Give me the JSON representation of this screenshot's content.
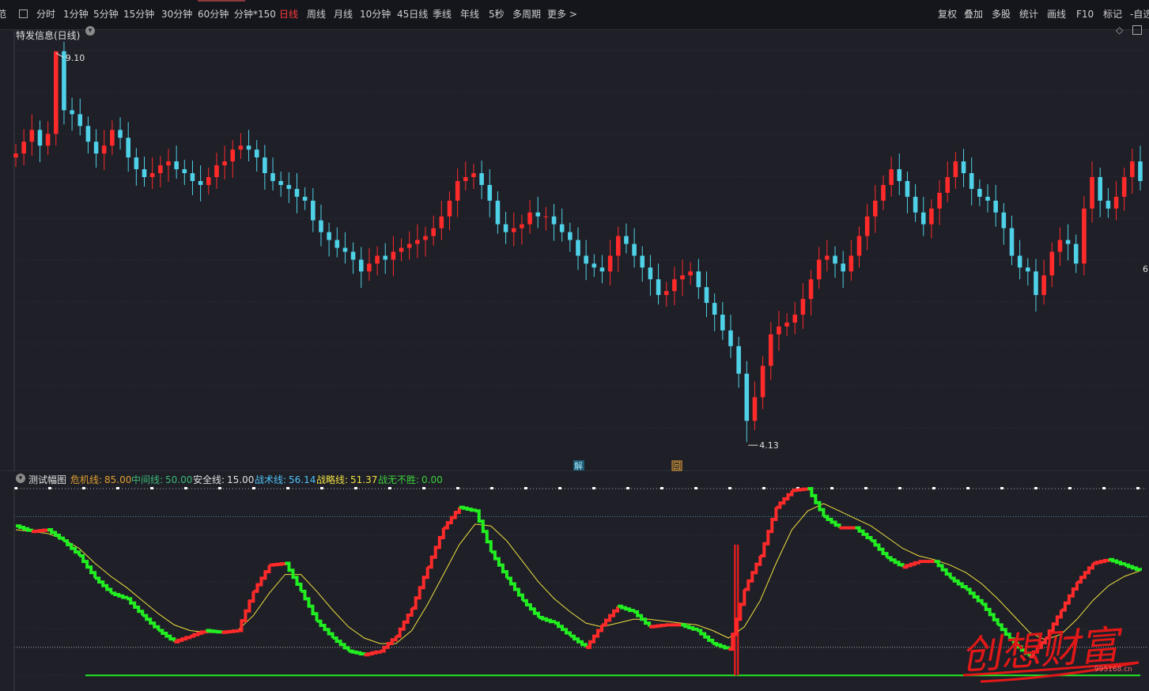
{
  "toolbar": {
    "left_fragment": "范",
    "periods": [
      "分时",
      "1分钟",
      "5分钟",
      "15分钟",
      "30分钟",
      "60分钟",
      "分钟*150",
      "日线",
      "周线",
      "月线",
      "10分钟",
      "45日线",
      "季线",
      "年线",
      "5秒",
      "多周期",
      "更多 >"
    ],
    "active_period": "日线",
    "tools": [
      "复权",
      "叠加",
      "多股",
      "统计",
      "画线",
      "F10",
      "标记",
      "-自选"
    ]
  },
  "main_panel": {
    "title": "特发信息(日线)",
    "high_label": "9.10",
    "low_label": "4.13",
    "badge_jie": "解",
    "badge_hui": "回",
    "right_edge_label": "6"
  },
  "sub_panel": {
    "name": "测试幅图",
    "indicators": [
      {
        "label": "危机线:",
        "value": "85.00",
        "color": "#e0a030"
      },
      {
        "label": "中间线:",
        "value": "50.00",
        "color": "#3cb878"
      },
      {
        "label": "安全线:",
        "value": "15.00",
        "color": "#e0e0e0"
      },
      {
        "label": "战术线:",
        "value": "56.14",
        "color": "#4fc3f7"
      },
      {
        "label": "战略线:",
        "value": "51.37",
        "color": "#f0e040"
      },
      {
        "label": "战无不胜:",
        "value": "0.00",
        "color": "#3cd03c"
      }
    ]
  },
  "watermark": {
    "text": "创想财富",
    "url": "995168.cn"
  },
  "colors": {
    "up": "#ff2a2a",
    "down": "#4fd1e8",
    "green": "#22ee22",
    "yellow": "#f0e040",
    "bg": "#1e1f27"
  },
  "chart_data": [
    {
      "type": "candlestick",
      "title": "特发信息(日线)",
      "ylim": [
        3.9,
        9.3
      ],
      "series": [
        {
          "values": [
            7.8,
            7.95,
            8.1,
            7.9,
            8.05,
            9.1,
            8.35,
            8.3,
            8.15,
            7.95,
            7.8,
            7.9,
            8.1,
            8.0,
            7.75,
            7.6,
            7.5,
            7.55,
            7.65,
            7.7,
            7.6,
            7.55,
            7.45,
            7.4,
            7.5,
            7.65,
            7.7,
            7.85,
            7.9,
            7.85,
            7.75,
            7.55,
            7.45,
            7.4,
            7.35,
            7.25,
            7.2,
            6.95,
            6.8,
            6.7,
            6.6,
            6.55,
            6.45,
            6.3,
            6.4,
            6.5,
            6.45,
            6.55,
            6.6,
            6.65,
            6.7,
            6.75,
            6.85,
            7.0,
            7.2,
            7.45,
            7.5,
            7.55,
            7.4,
            7.2,
            6.9,
            6.8,
            6.85,
            6.9,
            7.05,
            7.0,
            7.0,
            6.9,
            6.8,
            6.7,
            6.5,
            6.4,
            6.35,
            6.3,
            6.5,
            6.75,
            6.65,
            6.5,
            6.35,
            6.2,
            6.0,
            6.05,
            6.2,
            6.25,
            6.3,
            6.1,
            5.9,
            5.75,
            5.55,
            5.35,
            5.0,
            4.4,
            4.7,
            5.1,
            5.5,
            5.6,
            5.65,
            5.75,
            5.95,
            6.2,
            6.45,
            6.5,
            6.4,
            6.3,
            6.5,
            6.75,
            7.0,
            7.2,
            7.4,
            7.6,
            7.45,
            7.25,
            7.05,
            6.9,
            7.1,
            7.3,
            7.5,
            7.7,
            7.55,
            7.35,
            7.25,
            7.2,
            7.05,
            6.85,
            6.5,
            6.35,
            6.3,
            6.0,
            6.25,
            6.55,
            6.7,
            6.65,
            6.4,
            7.1,
            7.5,
            7.2,
            7.1,
            7.25,
            7.5,
            7.7,
            7.45
          ]
        }
      ]
    },
    {
      "type": "line",
      "title": "测试幅图",
      "ylim": [
        -5,
        100
      ],
      "series": [
        {
          "name": "战术线",
          "values": [
            80,
            77,
            78,
            72,
            64,
            52,
            44,
            41,
            32,
            24,
            18,
            21,
            24,
            23,
            24,
            45,
            59,
            60,
            45,
            29,
            20,
            13,
            11,
            13,
            21,
            36,
            58,
            79,
            90,
            88,
            66,
            52,
            40,
            31,
            28,
            21,
            15,
            27,
            37,
            34,
            26,
            27,
            27,
            24,
            17,
            14,
            46,
            64,
            90,
            99,
            100,
            85,
            79,
            79,
            72,
            63,
            58,
            61,
            61,
            52,
            46,
            38,
            27,
            17,
            10,
            20,
            35,
            50,
            60,
            62,
            59,
            56
          ]
        },
        {
          "name": "战略线",
          "values": [
            78,
            77,
            76,
            73,
            68,
            60,
            53,
            47,
            40,
            33,
            27,
            24,
            23,
            23,
            24,
            32,
            44,
            54,
            54,
            45,
            35,
            26,
            20,
            17,
            17,
            24,
            38,
            54,
            70,
            81,
            80,
            72,
            61,
            50,
            41,
            34,
            28,
            26,
            28,
            30,
            30,
            29,
            28,
            27,
            24,
            20,
            26,
            40,
            60,
            78,
            88,
            92,
            88,
            84,
            80,
            74,
            68,
            64,
            62,
            59,
            55,
            49,
            41,
            32,
            23,
            19,
            22,
            30,
            40,
            48,
            53,
            56
          ]
        }
      ]
    }
  ]
}
